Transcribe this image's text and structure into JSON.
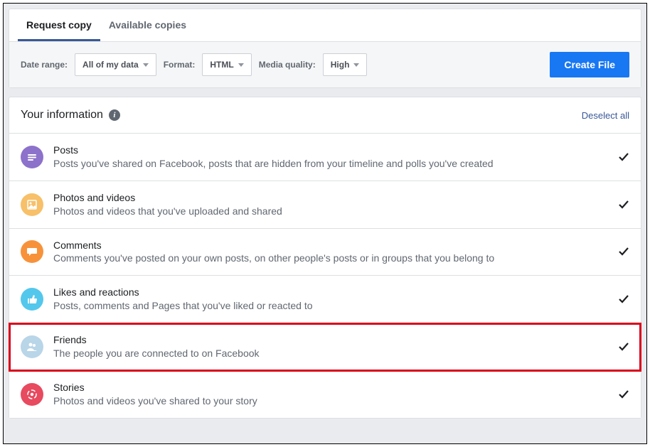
{
  "tabs": {
    "request": "Request copy",
    "available": "Available copies"
  },
  "filters": {
    "dateRangeLabel": "Date range:",
    "dateRangeValue": "All of my data",
    "formatLabel": "Format:",
    "formatValue": "HTML",
    "mediaQualityLabel": "Media quality:",
    "mediaQualityValue": "High",
    "createFile": "Create File"
  },
  "section": {
    "title": "Your information",
    "deselect": "Deselect all"
  },
  "items": [
    {
      "title": "Posts",
      "desc": "Posts you've shared on Facebook, posts that are hidden from your timeline and polls you've created",
      "icon": "posts"
    },
    {
      "title": "Photos and videos",
      "desc": "Photos and videos that you've uploaded and shared",
      "icon": "photos"
    },
    {
      "title": "Comments",
      "desc": "Comments you've posted on your own posts, on other people's posts or in groups that you belong to",
      "icon": "comments"
    },
    {
      "title": "Likes and reactions",
      "desc": "Posts, comments and Pages that you've liked or reacted to",
      "icon": "likes"
    },
    {
      "title": "Friends",
      "desc": "The people you are connected to on Facebook",
      "icon": "friends",
      "highlight": true
    },
    {
      "title": "Stories",
      "desc": "Photos and videos you've shared to your story",
      "icon": "stories"
    }
  ]
}
